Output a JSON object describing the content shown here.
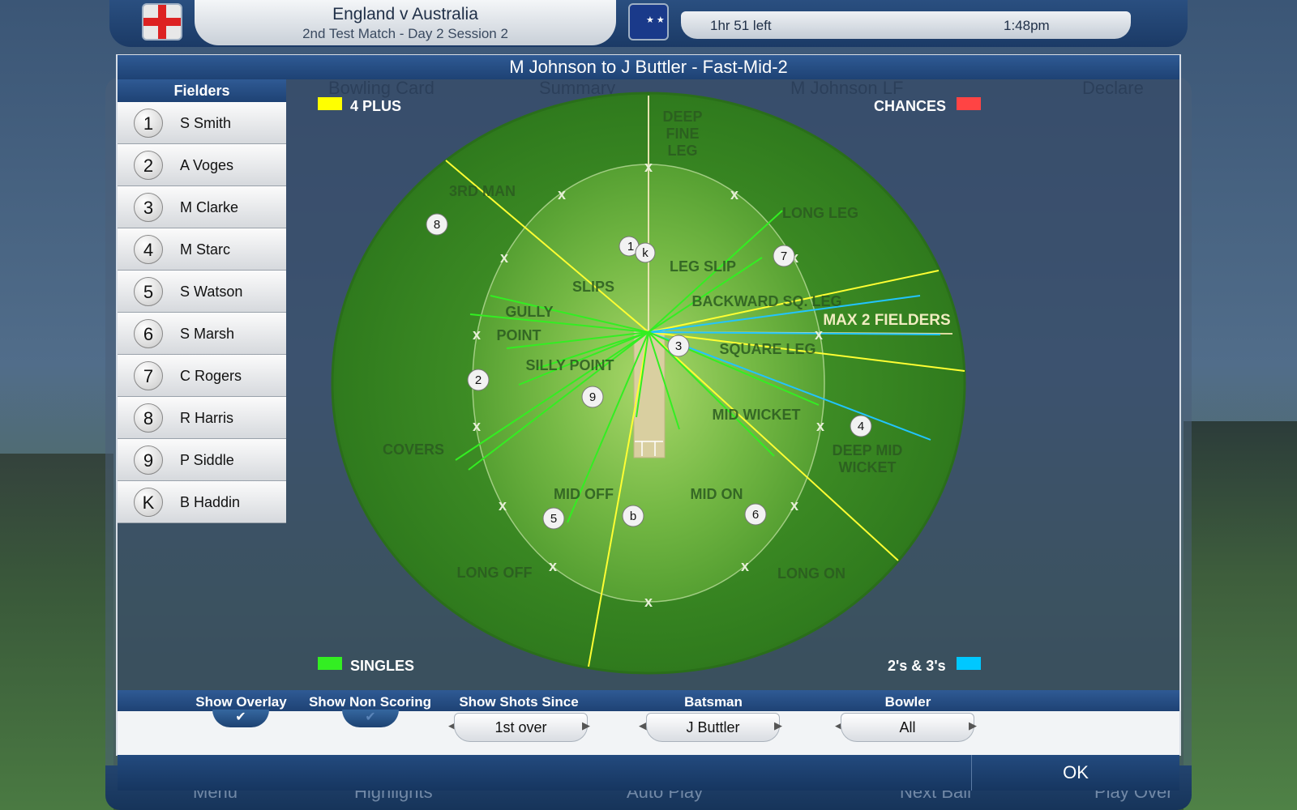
{
  "header": {
    "title": "England v Australia",
    "subtitle": "2nd Test Match - Day 2 Session 2",
    "time_left": "1hr 51 left",
    "clock": "1:48pm"
  },
  "background": {
    "tabs": [
      "Bowling Card",
      "Summary",
      "M Johnson LF",
      "Declare"
    ],
    "nav": [
      "Menu",
      "Highlights",
      "Auto Play",
      "Next Ball",
      "Play Over"
    ]
  },
  "dialog": {
    "title": "M Johnson to J Buttler - Fast-Mid-2",
    "fielders_header": "Fielders",
    "fielders": [
      {
        "num": "1",
        "name": "S Smith"
      },
      {
        "num": "2",
        "name": "A Voges"
      },
      {
        "num": "3",
        "name": "M Clarke"
      },
      {
        "num": "4",
        "name": "M Starc"
      },
      {
        "num": "5",
        "name": "S Watson"
      },
      {
        "num": "6",
        "name": "S Marsh"
      },
      {
        "num": "7",
        "name": "C Rogers"
      },
      {
        "num": "8",
        "name": "R Harris"
      },
      {
        "num": "9",
        "name": "P Siddle"
      },
      {
        "num": "K",
        "name": "B Haddin"
      }
    ],
    "legend": {
      "four_plus": "4 PLUS",
      "chances": "CHANCES",
      "singles": "SINGLES",
      "twos_threes": "2's & 3's",
      "colors": {
        "four_plus": "#ffff00",
        "chances": "#ff4444",
        "singles": "#33ee22",
        "twos_threes": "#00c8ff"
      }
    },
    "field_labels": {
      "deep_fine_leg_1": "DEEP",
      "deep_fine_leg_2": "FINE",
      "deep_fine_leg_3": "LEG",
      "third_man": "3RD MAN",
      "long_leg": "LONG LEG",
      "leg_slip": "LEG SLIP",
      "slips": "SLIPS",
      "gully": "GULLY",
      "backward_sq_leg": "BACKWARD SQ. LEG",
      "max_fielders": "MAX 2 FIELDERS",
      "point": "POINT",
      "silly_point": "SILLY POINT",
      "square_leg": "SQUARE LEG",
      "mid_wicket": "MID WICKET",
      "deep_mid_wicket_1": "DEEP MID",
      "deep_mid_wicket_2": "WICKET",
      "covers": "COVERS",
      "mid_off": "MID OFF",
      "mid_on": "MID ON",
      "long_off": "LONG OFF",
      "long_on": "LONG ON"
    },
    "markers": {
      "m1": "1",
      "k": "k",
      "m2": "2",
      "m3": "3",
      "m4": "4",
      "m5": "5",
      "m6": "6",
      "m7": "7",
      "m8": "8",
      "m9": "9",
      "b": "b",
      "x": "x"
    },
    "controls": {
      "show_overlay": "Show Overlay",
      "show_non_scoring": "Show Non Scoring",
      "show_shots_since": "Show Shots Since",
      "shots_since_value": "1st over",
      "batsman": "Batsman",
      "batsman_value": "J Buttler",
      "bowler": "Bowler",
      "bowler_value": "All",
      "ok": "OK",
      "check_glyph": "✔"
    }
  }
}
